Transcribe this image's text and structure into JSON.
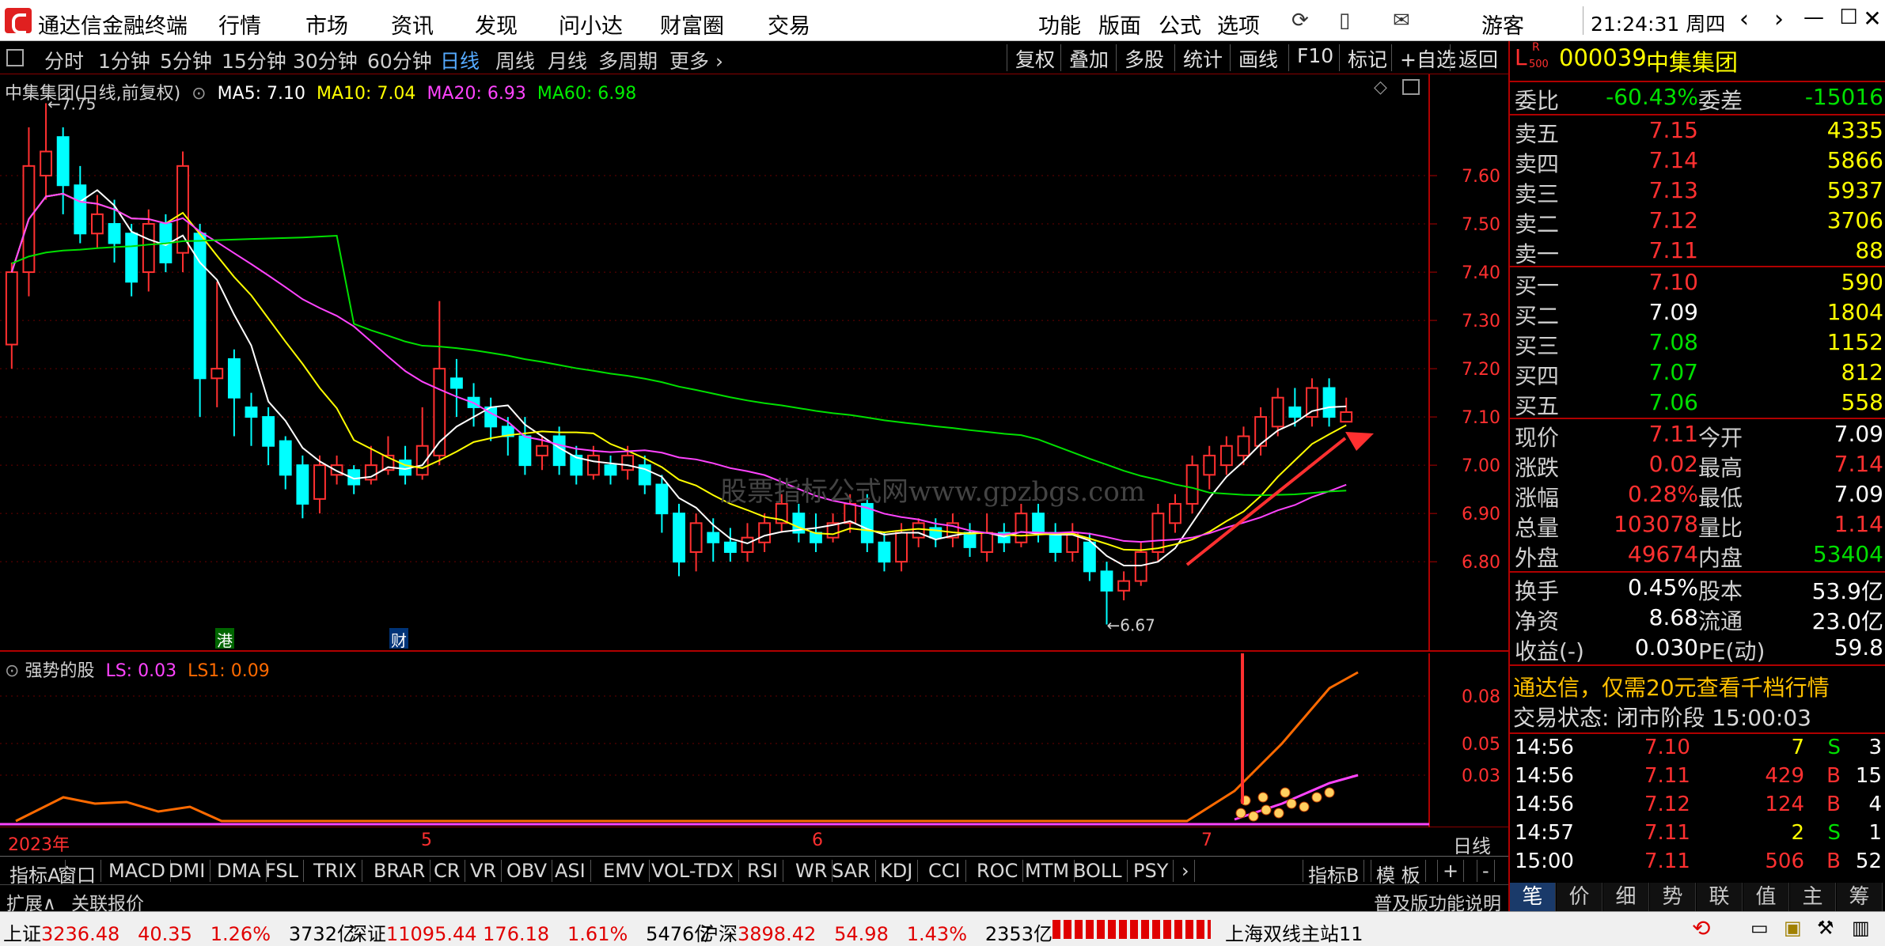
{
  "app": {
    "title": "通达信金融终端",
    "user": "游客",
    "clock": "21:24:31 周四"
  },
  "top_menu": [
    "行情",
    "市场",
    "资讯",
    "发现",
    "问小达",
    "财富圈",
    "交易"
  ],
  "tool_menu": [
    "功能",
    "版面",
    "公式",
    "选项"
  ],
  "periods": [
    "分时",
    "1分钟",
    "5分钟",
    "15分钟",
    "30分钟",
    "60分钟",
    "日线",
    "周线",
    "月线",
    "多周期",
    "更多"
  ],
  "active_period": "日线",
  "chart_tools": [
    "复权",
    "叠加",
    "多股",
    "统计",
    "画线",
    "F10",
    "标记",
    "+自选",
    "返回"
  ],
  "main_chart": {
    "header": "中集集团(日线,前复权)",
    "ma5": "MA5: 7.10",
    "ma10": "MA10: 7.04",
    "ma20": "MA20: 6.93",
    "ma60": "MA60: 6.98",
    "high_label": "7.75",
    "low_label": "6.67",
    "marker_gang": "港",
    "marker_cai": "财",
    "watermark": "股票指标公式网www.gpzbgs.com",
    "y_ticks": [
      "7.60",
      "7.50",
      "7.40",
      "7.30",
      "7.20",
      "7.10",
      "7.00",
      "6.90",
      "6.80"
    ]
  },
  "sub_chart": {
    "name": "强势的股",
    "ls": "LS: 0.03",
    "ls1": "LS1: 0.09",
    "y_ticks": [
      "0.08",
      "0.05",
      "0.03"
    ]
  },
  "date_axis": {
    "labels": [
      "2023年",
      "5",
      "6",
      "7"
    ],
    "period": "日线"
  },
  "indicators": [
    "指标A",
    "窗口",
    "MACD",
    "DMI",
    "DMA",
    "FSL",
    "TRIX",
    "BRAR",
    "CR",
    "VR",
    "OBV",
    "ASI",
    "EMV",
    "VOL-TDX",
    "RSI",
    "WR",
    "SAR",
    "KDJ",
    "CCI",
    "ROC",
    "MTM",
    "BOLL",
    "PSY"
  ],
  "indicator_right": [
    "指标B",
    "模 板",
    "+",
    "-"
  ],
  "ext_bar": {
    "expand": "扩展∧",
    "related": "关联报价",
    "help": "普及版功能说明"
  },
  "quote": {
    "badge": "L",
    "badge_sup": "R",
    "badge_sub": "500",
    "code": "000039",
    "name": "中集集团",
    "weibi_label": "委比",
    "weibi": "-60.43%",
    "weicha_label": "委差",
    "weicha": "-15016",
    "asks": [
      {
        "label": "卖五",
        "price": "7.15",
        "vol": "4335"
      },
      {
        "label": "卖四",
        "price": "7.14",
        "vol": "5866"
      },
      {
        "label": "卖三",
        "price": "7.13",
        "vol": "5937"
      },
      {
        "label": "卖二",
        "price": "7.12",
        "vol": "3706"
      },
      {
        "label": "卖一",
        "price": "7.11",
        "vol": "88"
      }
    ],
    "bids": [
      {
        "label": "买一",
        "price": "7.10",
        "vol": "590"
      },
      {
        "label": "买二",
        "price": "7.09",
        "vol": "1804"
      },
      {
        "label": "买三",
        "price": "7.08",
        "vol": "1152"
      },
      {
        "label": "买四",
        "price": "7.07",
        "vol": "812"
      },
      {
        "label": "买五",
        "price": "7.06",
        "vol": "558"
      }
    ],
    "stats": [
      {
        "l1": "现价",
        "v1": "7.11",
        "l2": "今开",
        "v2": "7.09"
      },
      {
        "l1": "涨跌",
        "v1": "0.02",
        "l2": "最高",
        "v2": "7.14"
      },
      {
        "l1": "涨幅",
        "v1": "0.28%",
        "l2": "最低",
        "v2": "7.09"
      },
      {
        "l1": "总量",
        "v1": "103078",
        "l2": "量比",
        "v2": "1.14"
      },
      {
        "l1": "外盘",
        "v1": "49674",
        "l2": "内盘",
        "v2": "53404"
      }
    ],
    "stats2": [
      {
        "l1": "换手",
        "v1": "0.45%",
        "l2": "股本",
        "v2": "53.9亿"
      },
      {
        "l1": "净资",
        "v1": "8.68",
        "l2": "流通",
        "v2": "23.0亿"
      },
      {
        "l1": "收益(-)",
        "v1": "0.030",
        "l2": "PE(动)",
        "v2": "59.8"
      }
    ],
    "promo": "通达信，仅需20元查看千档行情",
    "trade_status": "交易状态: 闭市阶段 15:00:03",
    "ticks": [
      {
        "t": "14:56",
        "p": "7.10",
        "v": "7",
        "d": "S",
        "n": "3"
      },
      {
        "t": "14:56",
        "p": "7.11",
        "v": "429",
        "d": "B",
        "n": "15"
      },
      {
        "t": "14:56",
        "p": "7.12",
        "v": "124",
        "d": "B",
        "n": "4"
      },
      {
        "t": "14:57",
        "p": "7.11",
        "v": "2",
        "d": "S",
        "n": "1"
      },
      {
        "t": "15:00",
        "p": "7.11",
        "v": "506",
        "d": "B",
        "n": "52"
      }
    ],
    "tabs": [
      "笔",
      "价",
      "细",
      "势",
      "联",
      "值",
      "主",
      "筹"
    ]
  },
  "statusbar": {
    "sh_label": "上证",
    "sh": "3236.48",
    "sh_chg": "40.35",
    "sh_pct": "1.26%",
    "sh_amt": "3732亿",
    "sz_label": "深证",
    "sz": "11095.44",
    "sz_chg": "176.18",
    "sz_pct": "1.61%",
    "sz_amt": "5476亿",
    "hs_label": "沪深",
    "hs": "3898.42",
    "hs_chg": "54.98",
    "hs_pct": "1.43%",
    "hs_amt": "2353亿",
    "server": "上海双线主站11"
  },
  "colors": {
    "up": "#ff3030",
    "down": "#00ffff",
    "ma5": "#ffffff",
    "ma10": "#ffff00",
    "ma20": "#ff44ff",
    "ma60": "#00e000",
    "ls": "#ff44ff",
    "ls1": "#ff6a00"
  },
  "chart_data": {
    "type": "candlestick",
    "y_range": [
      6.62,
      7.8
    ],
    "candles": [
      [
        7.25,
        7.4,
        7.42,
        7.2
      ],
      [
        7.4,
        7.62,
        7.7,
        7.35
      ],
      [
        7.6,
        7.65,
        7.75,
        7.55
      ],
      [
        7.68,
        7.58,
        7.7,
        7.52
      ],
      [
        7.58,
        7.48,
        7.62,
        7.46
      ],
      [
        7.48,
        7.52,
        7.56,
        7.45
      ],
      [
        7.5,
        7.46,
        7.55,
        7.42
      ],
      [
        7.48,
        7.38,
        7.5,
        7.35
      ],
      [
        7.4,
        7.5,
        7.53,
        7.36
      ],
      [
        7.5,
        7.42,
        7.52,
        7.4
      ],
      [
        7.44,
        7.62,
        7.65,
        7.4
      ],
      [
        7.48,
        7.18,
        7.5,
        7.1
      ],
      [
        7.18,
        7.2,
        7.38,
        7.12
      ],
      [
        7.22,
        7.14,
        7.24,
        7.06
      ],
      [
        7.12,
        7.1,
        7.15,
        7.04
      ],
      [
        7.1,
        7.04,
        7.12,
        7.0
      ],
      [
        7.05,
        6.98,
        7.06,
        6.95
      ],
      [
        7.0,
        6.92,
        7.02,
        6.89
      ],
      [
        6.93,
        7.0,
        7.02,
        6.9
      ],
      [
        6.98,
        7.0,
        7.02,
        6.96
      ],
      [
        6.99,
        6.96,
        7.0,
        6.94
      ],
      [
        6.97,
        7.0,
        7.04,
        6.96
      ],
      [
        6.99,
        7.02,
        7.06,
        6.98
      ],
      [
        7.01,
        6.98,
        7.04,
        6.96
      ],
      [
        6.98,
        7.04,
        7.12,
        6.97
      ],
      [
        7.02,
        7.2,
        7.34,
        7.0
      ],
      [
        7.18,
        7.16,
        7.22,
        7.1
      ],
      [
        7.14,
        7.12,
        7.17,
        7.08
      ],
      [
        7.12,
        7.08,
        7.14,
        7.05
      ],
      [
        7.08,
        7.06,
        7.1,
        7.02
      ],
      [
        7.06,
        7.0,
        7.1,
        6.98
      ],
      [
        7.02,
        7.04,
        7.06,
        6.99
      ],
      [
        7.06,
        7.0,
        7.08,
        6.98
      ],
      [
        7.02,
        6.98,
        7.04,
        6.96
      ],
      [
        6.98,
        7.02,
        7.04,
        6.97
      ],
      [
        7.0,
        6.98,
        7.02,
        6.96
      ],
      [
        6.99,
        7.02,
        7.04,
        6.97
      ],
      [
        7.0,
        6.96,
        7.02,
        6.94
      ],
      [
        6.96,
        6.9,
        6.98,
        6.86
      ],
      [
        6.9,
        6.8,
        6.92,
        6.77
      ],
      [
        6.82,
        6.88,
        6.9,
        6.78
      ],
      [
        6.86,
        6.84,
        6.89,
        6.8
      ],
      [
        6.84,
        6.82,
        6.87,
        6.8
      ],
      [
        6.82,
        6.85,
        6.88,
        6.8
      ],
      [
        6.84,
        6.88,
        6.9,
        6.82
      ],
      [
        6.88,
        6.92,
        6.94,
        6.86
      ],
      [
        6.9,
        6.86,
        6.92,
        6.84
      ],
      [
        6.86,
        6.84,
        6.9,
        6.82
      ],
      [
        6.85,
        6.88,
        6.9,
        6.84
      ],
      [
        6.88,
        6.92,
        6.94,
        6.86
      ],
      [
        6.92,
        6.84,
        6.94,
        6.82
      ],
      [
        6.84,
        6.8,
        6.86,
        6.78
      ],
      [
        6.8,
        6.86,
        6.88,
        6.78
      ],
      [
        6.85,
        6.88,
        6.89,
        6.83
      ],
      [
        6.87,
        6.85,
        6.89,
        6.83
      ],
      [
        6.85,
        6.88,
        6.9,
        6.83
      ],
      [
        6.86,
        6.83,
        6.88,
        6.81
      ],
      [
        6.82,
        6.86,
        6.9,
        6.8
      ],
      [
        6.86,
        6.84,
        6.88,
        6.82
      ],
      [
        6.84,
        6.9,
        6.92,
        6.83
      ],
      [
        6.9,
        6.86,
        6.92,
        6.84
      ],
      [
        6.86,
        6.82,
        6.88,
        6.8
      ],
      [
        6.82,
        6.86,
        6.88,
        6.8
      ],
      [
        6.84,
        6.78,
        6.86,
        6.76
      ],
      [
        6.78,
        6.74,
        6.8,
        6.67
      ],
      [
        6.74,
        6.76,
        6.78,
        6.72
      ],
      [
        6.76,
        6.82,
        6.84,
        6.75
      ],
      [
        6.82,
        6.9,
        6.92,
        6.8
      ],
      [
        6.88,
        6.92,
        6.94,
        6.86
      ],
      [
        6.92,
        7.0,
        7.02,
        6.9
      ],
      [
        6.98,
        7.02,
        7.04,
        6.95
      ],
      [
        7.0,
        7.04,
        7.06,
        6.98
      ],
      [
        7.02,
        7.06,
        7.08,
        7.0
      ],
      [
        7.04,
        7.1,
        7.12,
        7.02
      ],
      [
        7.08,
        7.14,
        7.16,
        7.06
      ],
      [
        7.12,
        7.1,
        7.16,
        7.08
      ],
      [
        7.1,
        7.16,
        7.18,
        7.08
      ],
      [
        7.16,
        7.1,
        7.18,
        7.08
      ],
      [
        7.09,
        7.11,
        7.14,
        7.09
      ]
    ]
  }
}
